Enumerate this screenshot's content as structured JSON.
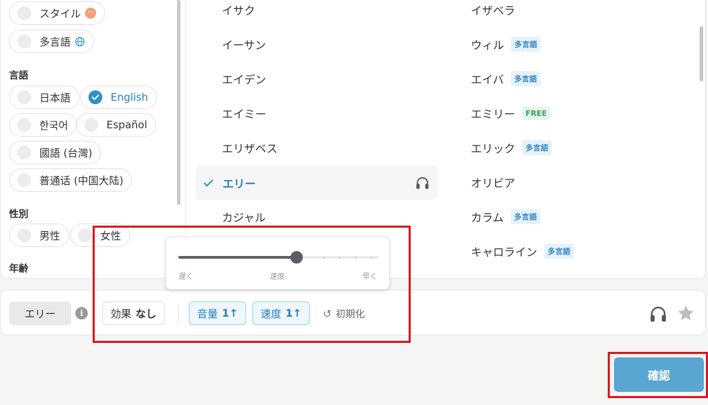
{
  "sidebar": {
    "style_chips": [
      {
        "label": "スタイル",
        "icon": "smiley-icon"
      },
      {
        "label": "多言語",
        "icon": "globe-icon"
      }
    ],
    "language_heading": "言語",
    "languages": [
      {
        "label": "日本語",
        "selected": false
      },
      {
        "label": "English",
        "selected": true
      },
      {
        "label": "한국어",
        "selected": false
      },
      {
        "label": "Español",
        "selected": false
      },
      {
        "label": "國語 (台灣)",
        "selected": false
      },
      {
        "label": "普通话 (中国大陆)",
        "selected": false
      }
    ],
    "gender_heading": "性別",
    "genders": [
      {
        "label": "男性"
      },
      {
        "label": "女性"
      }
    ],
    "age_heading": "年齢"
  },
  "voices": {
    "left": [
      {
        "name": "イサク"
      },
      {
        "name": "イーサン"
      },
      {
        "name": "エイデン"
      },
      {
        "name": "エイミー"
      },
      {
        "name": "エリザベス"
      },
      {
        "name": "エリー",
        "selected": true
      },
      {
        "name": "カジャル"
      }
    ],
    "right": [
      {
        "name": "イザベラ",
        "badge": ""
      },
      {
        "name": "ウィル",
        "badge": "多言語"
      },
      {
        "name": "エイバ",
        "badge": "多言語"
      },
      {
        "name": "エミリー",
        "badge": "FREE"
      },
      {
        "name": "エリック",
        "badge": "多言語"
      },
      {
        "name": "オリビア",
        "badge": ""
      },
      {
        "name": "カラム",
        "badge": "多言語"
      },
      {
        "name": "キャロライン",
        "badge": "多言語"
      }
    ]
  },
  "speed_popover": {
    "value_fraction": 0.59,
    "slow_label": "遅く",
    "speed_label": "速度",
    "fast_label": "早く"
  },
  "toolbar": {
    "voice_name": "エリー",
    "info_glyph": "i",
    "effect_label": "効果",
    "effect_value": "なし",
    "volume_label": "音量",
    "volume_value": "1↑",
    "speed_label": "速度",
    "speed_value": "1↑",
    "reset_glyph": "↺",
    "reset_label": "初期化"
  },
  "confirm_label": "確認",
  "colors": {
    "accent": "#2f8fd0",
    "confirm": "#5aa6d2",
    "highlight": "#e0141e",
    "free_badge": "#3fa05f"
  }
}
